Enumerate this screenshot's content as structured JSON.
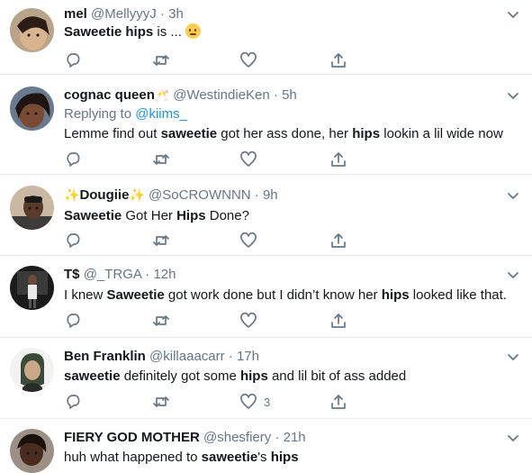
{
  "tweets": [
    {
      "name": "mel",
      "handle": "@MellyyyJ",
      "time": "3h",
      "body_parts": [
        "Saweetie hips",
        " is ... "
      ],
      "emoji": "neutral-face-icon",
      "reply_count": "",
      "retweet_count": "",
      "like_count": ""
    },
    {
      "name": "cognac queen",
      "name_emoji": "🥂",
      "handle": "@WestindieKen",
      "time": "5h",
      "replying_label": "Replying to ",
      "replying_to": "@kiims_",
      "body_parts": [
        "Lemme find out ",
        "saweetie",
        " got her ass done, her ",
        "hips",
        " lookin a lil wide now"
      ]
    },
    {
      "name": "Dougiie",
      "name_prefix": "✨",
      "name_suffix": "✨",
      "handle": "@SoCROWNNN",
      "time": "9h",
      "body_parts": [
        "Saweetie",
        " Got Her ",
        "Hips",
        " Done?"
      ]
    },
    {
      "name": "T$",
      "handle": "@_TRGA",
      "time": "12h",
      "body_parts": [
        "I knew ",
        "Saweetie",
        " got work done but I didn’t know her ",
        "hips",
        " looked like that."
      ]
    },
    {
      "name": "Ben Franklin",
      "handle": "@killaaacarr",
      "time": "17h",
      "body_parts": [
        "saweetie",
        " definitely got some ",
        "hips",
        " and lil bit of ass added"
      ],
      "like_count": "3"
    },
    {
      "name": "FIERY GOD MOTHER",
      "handle": "@shesfiery",
      "time": "21h",
      "body_parts": [
        "huh what happened to ",
        "saweetie",
        "'s ",
        "hips"
      ]
    }
  ],
  "separator": "·",
  "colors": {
    "text": "#14171a",
    "muted": "#657786",
    "link": "#1b95e0",
    "border": "#e6ecf0"
  }
}
